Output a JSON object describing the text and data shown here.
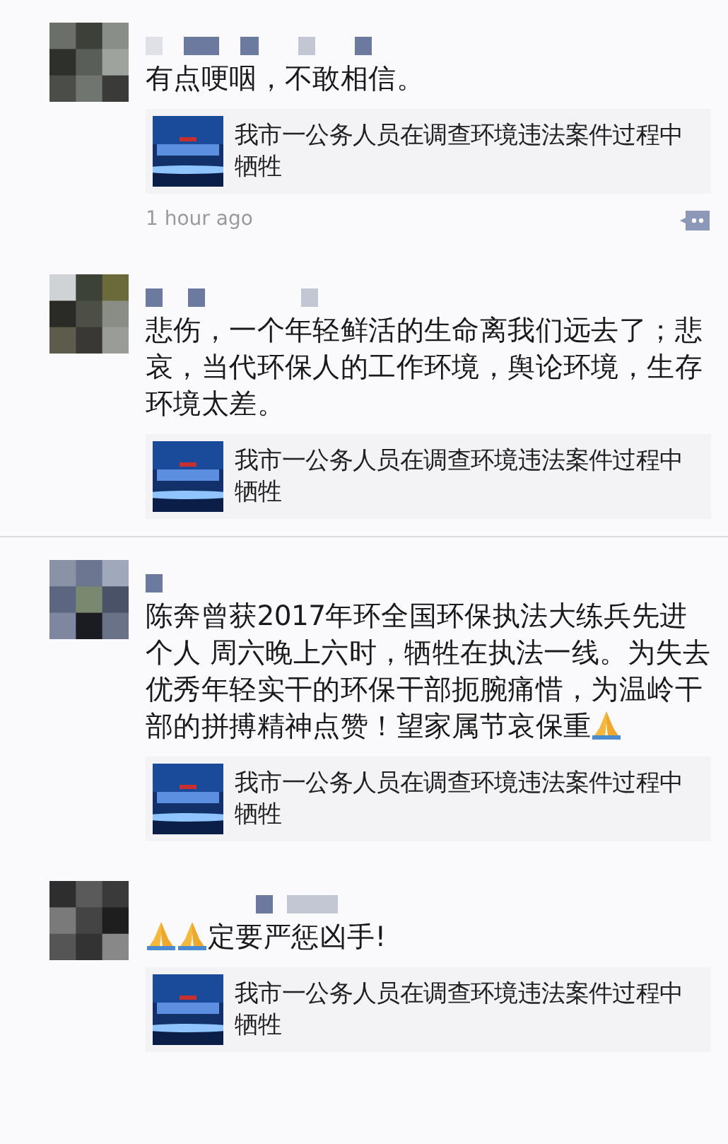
{
  "posts": [
    {
      "segments": [
        {
          "kind": "text",
          "text": "有点哽咽，不敢相信。"
        }
      ],
      "link": {
        "title": "我市一公务人员在调查环境违法案件过程中牺牲"
      },
      "time": "1 hour ago",
      "divider": false
    },
    {
      "segments": [
        {
          "kind": "text",
          "text": "悲伤，一个年轻鲜活的生命离我们远去了；悲哀，当代环保人的工作环境，舆论环境，生存环境太差。"
        }
      ],
      "link": {
        "title": "我市一公务人员在调查环境违法案件过程中牺牲"
      },
      "divider": true
    },
    {
      "segments": [
        {
          "kind": "text",
          "text": "陈奔曾获2017年环全国环保执法大练兵先进个人 周六晚上六时，牺牲在执法一线。为失去优秀年轻实干的环保干部扼腕痛惜，为温岭干部的拼搏精神点赞！望家属节哀保重"
        },
        {
          "kind": "prayer"
        }
      ],
      "link": {
        "title": "我市一公务人员在调查环境违法案件过程中牺牲"
      },
      "divider": false
    },
    {
      "segments": [
        {
          "kind": "prayer"
        },
        {
          "kind": "prayer"
        },
        {
          "kind": "text",
          "text": "定要严惩凶手!"
        }
      ],
      "link": {
        "title": "我市一公务人员在调查环境违法案件过程中牺牲"
      },
      "divider": false
    }
  ]
}
